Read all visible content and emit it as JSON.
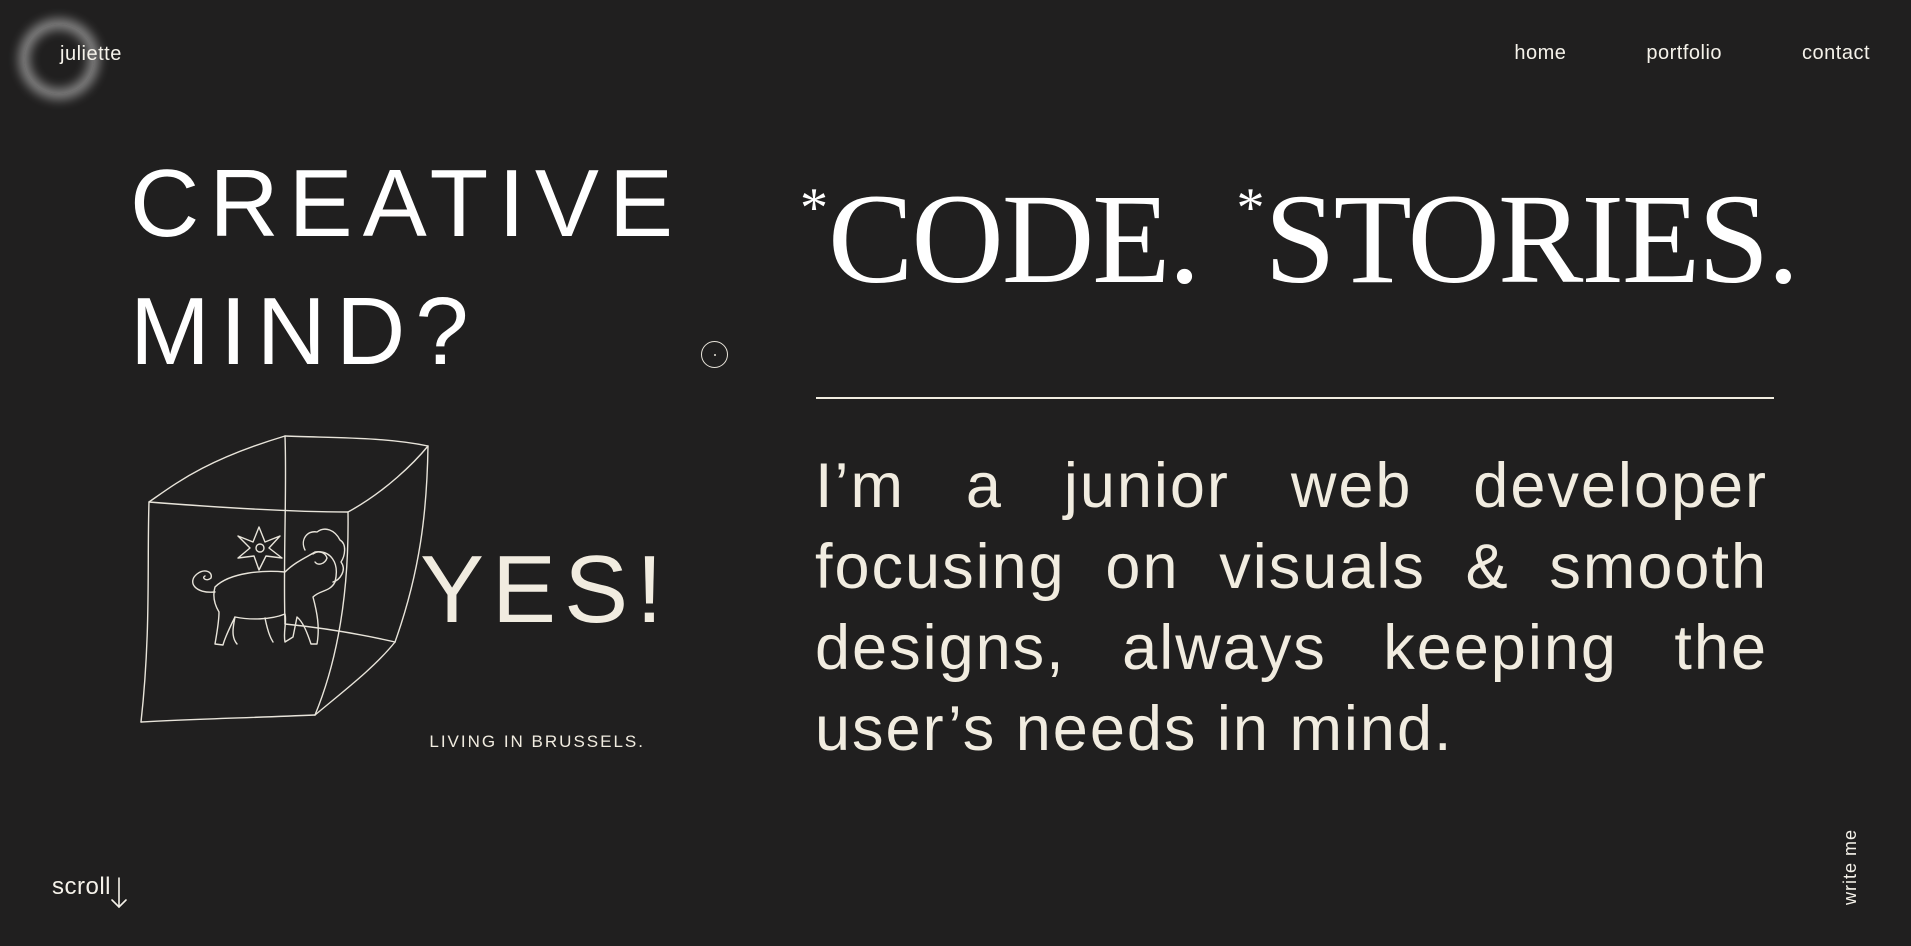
{
  "header": {
    "logo_text": "juliette",
    "nav": [
      {
        "label": "home"
      },
      {
        "label": "portfolio"
      },
      {
        "label": "contact"
      }
    ]
  },
  "hero": {
    "headline_left": [
      "CREATIVE",
      "MIND?"
    ],
    "yes_text": "YES!",
    "location_text": "LIVING IN BRUSSELS.",
    "headline_right": {
      "star": "*",
      "word1": "CODE.",
      "word2": "STORIES."
    },
    "intro_text": "I’m a junior web developer focusing on visuals & smooth designs, always keeping the user’s needs in mind."
  },
  "footer": {
    "scroll_label": "scroll",
    "write_me_label": "write me"
  },
  "colors": {
    "background": "#201f1f",
    "text_primary": "#ffffff",
    "text_cream": "#f1ece0"
  }
}
